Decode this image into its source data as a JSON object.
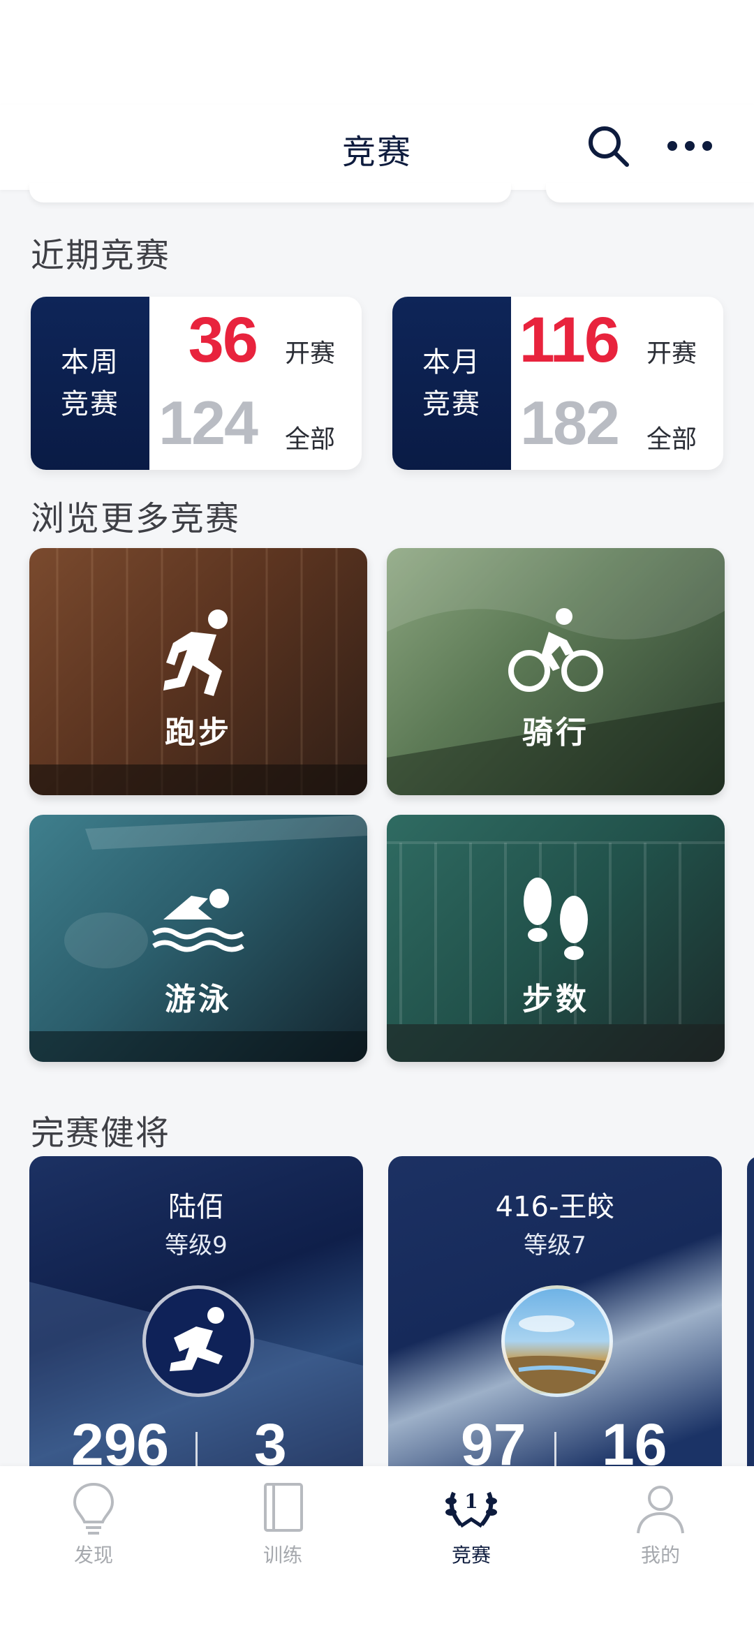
{
  "header": {
    "title": "竞赛",
    "search_icon": "search-icon",
    "more_icon": "more-icon"
  },
  "recent": {
    "section_title": "近期竞赛",
    "cards": [
      {
        "side_line1": "本周",
        "side_line2": "竞赛",
        "open_count": "36",
        "open_label": "开赛",
        "total_count": "124",
        "total_label": "全部"
      },
      {
        "side_line1": "本月",
        "side_line2": "竞赛",
        "open_count": "116",
        "open_label": "开赛",
        "total_count": "182",
        "total_label": "全部"
      }
    ]
  },
  "browse": {
    "section_title": "浏览更多竞赛",
    "tiles": [
      {
        "label": "跑步",
        "icon": "running-icon"
      },
      {
        "label": "骑行",
        "icon": "cycling-icon"
      },
      {
        "label": "游泳",
        "icon": "swimming-icon"
      },
      {
        "label": "步数",
        "icon": "footprints-icon"
      }
    ]
  },
  "finishers": {
    "section_title": "完赛健将",
    "athletes": [
      {
        "name": "陆佰",
        "level": "等级9",
        "stat_left": "296",
        "stat_right": "3",
        "avatar_icon": "runner-avatar-icon"
      },
      {
        "name": "416-王皎",
        "level": "等级7",
        "stat_left": "97",
        "stat_right": "16",
        "avatar_icon": "landscape-avatar-icon"
      }
    ]
  },
  "nav": {
    "items": [
      {
        "label": "发现",
        "icon": "lightbulb-icon",
        "active": false
      },
      {
        "label": "训练",
        "icon": "book-icon",
        "active": false
      },
      {
        "label": "竞赛",
        "icon": "laurel-trophy-icon",
        "active": true,
        "badge": "1"
      },
      {
        "label": "我的",
        "icon": "user-icon",
        "active": false
      }
    ]
  },
  "colors": {
    "navy": "#0d1b3d",
    "accent_red": "#e8233d",
    "muted_gray": "#b9bcc3"
  }
}
